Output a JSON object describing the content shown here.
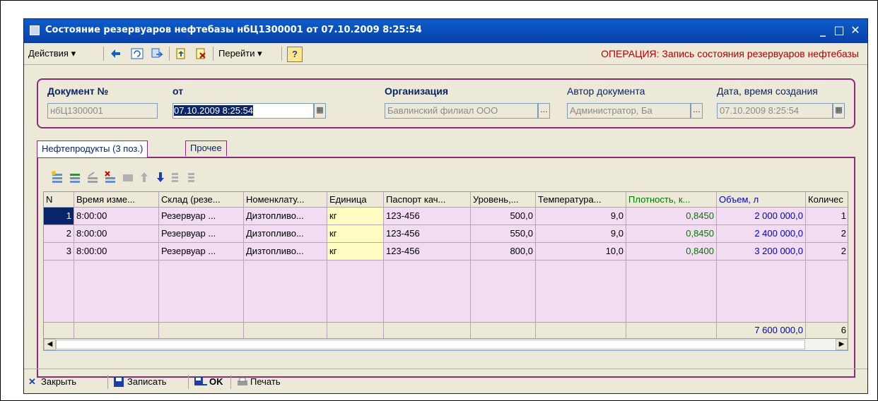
{
  "window": {
    "title": "Состояние резервуаров нефтебазы нбЦ1300001 от 07.10.2009 8:25:54",
    "minimize_glyph": "_",
    "maximize_glyph": "□",
    "close_glyph": "✕"
  },
  "toolbar": {
    "actions_label": "Действия ▾",
    "goto_label": "Перейти ▾",
    "help_label": "?",
    "operation_text": "ОПЕРАЦИЯ: Запись состояния резервуаров нефтебазы",
    "icons": [
      "arrow-left-icon",
      "refresh-icon",
      "swap-icon",
      "document-up-icon",
      "document-delete-icon"
    ]
  },
  "header": {
    "doc_number_label": "Документ №",
    "doc_number_value": "нбЦ1300001",
    "date_label": "от",
    "date_value": "07.10.2009  8:25:54",
    "org_label": "Организация",
    "org_value": "Бавлинский филиал ООО",
    "author_label": "Автор документа",
    "author_value": "Администратор, Ба",
    "created_label": "Дата, время создания",
    "created_value": "07.10.2009  8:25:54",
    "ellipsis": "..."
  },
  "tabs": [
    {
      "label": "Нефтепродукты (3 поз.)",
      "active": true
    },
    {
      "label": "Прочее",
      "active": false
    }
  ],
  "grid": {
    "columns": [
      "N",
      "Время изме...",
      "Склад (резе...",
      "Номенклату...",
      "Единица",
      "Паспорт кач...",
      "Уровень,...",
      "Температура...",
      "Плотность, к...",
      "Объем, л",
      "Количес"
    ],
    "rows": [
      [
        "1",
        "8:00:00",
        "Резервуар ...",
        "Дизтопливо...",
        "кг",
        "123-456",
        "500,0",
        "9,0",
        "0,8450",
        "2 000 000,0",
        "1"
      ],
      [
        "2",
        "8:00:00",
        "Резервуар ...",
        "Дизтопливо...",
        "кг",
        "123-456",
        "550,0",
        "9,0",
        "0,8450",
        "2 400 000,0",
        "2"
      ],
      [
        "3",
        "8:00:00",
        "Резервуар ...",
        "Дизтопливо...",
        "кг",
        "123-456",
        "800,0",
        "10,0",
        "0,8400",
        "3 200 000,0",
        "2"
      ]
    ],
    "total_volume": "7 600 000,0",
    "total_qty": "6"
  },
  "bottom": {
    "close_label": "Закрыть",
    "save_label": "Записать",
    "ok_label": "OK",
    "print_label": "Печать"
  },
  "colors": {
    "accent_border": "#8c2a7a",
    "operation_red": "#b30000",
    "grid_row_bg": "#f2dcf2"
  }
}
